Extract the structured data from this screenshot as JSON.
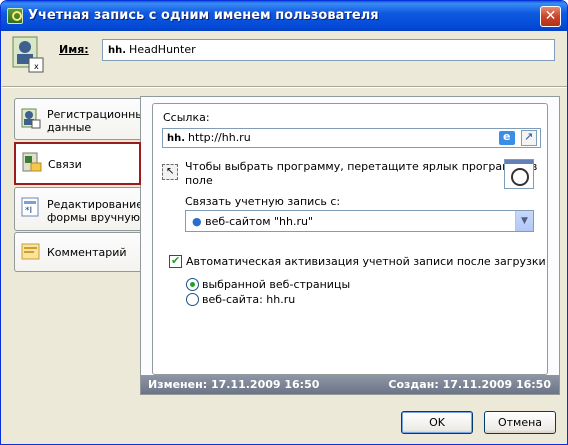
{
  "window": {
    "title": "Учетная запись с одним именем пользователя",
    "close_glyph": "✕"
  },
  "header": {
    "name_label": "Имя:",
    "name_logo": "hh.",
    "name_value": "HeadHunter"
  },
  "tabs": [
    {
      "label_line1": "Регистрационные",
      "label_line2": "данные",
      "icon": "user-card-icon"
    },
    {
      "label_line1": "Связи",
      "label_line2": "",
      "icon": "links-icon",
      "active": true
    },
    {
      "label_line1": "Редактирование",
      "label_line2": "формы вручную",
      "icon": "form-edit-icon"
    },
    {
      "label_line1": "Комментарий",
      "label_line2": "",
      "icon": "comment-icon"
    }
  ],
  "links_page": {
    "url_label": "Ссылка:",
    "url_logo": "hh.",
    "url_value": "http://hh.ru",
    "drag_hint_line1": "Чтобы выбрать программу, перетащите ярлык программы в",
    "drag_hint_line2": "поле",
    "link_label": "Связать учетную запись с:",
    "link_value": "веб-сайтом  \"hh.ru\"",
    "autologin_label": "Автоматическая активизация учетной записи после загрузки",
    "autologin_checked": true,
    "radio_selected_page": "выбранной веб-страницы",
    "radio_website": "веб-сайта: hh.ru"
  },
  "status": {
    "modified": "Изменен: 17.11.2009 16:50",
    "created": "Создан: 17.11.2009 16:50"
  },
  "buttons": {
    "ok": "OK",
    "cancel": "Отмена"
  },
  "colors": {
    "titlebar": "#0348d6",
    "active_tab_border": "#9b1c1c",
    "status_bg": "#7b8394",
    "brand_red": "#d6001c"
  }
}
